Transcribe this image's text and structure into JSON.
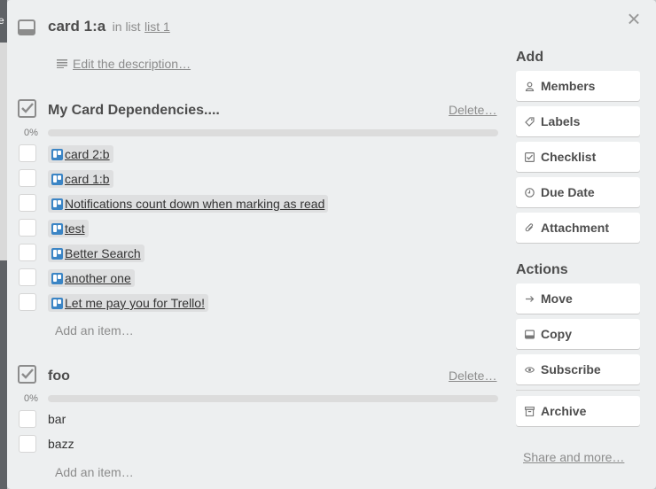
{
  "colors": {
    "modal_bg": "#edeff0",
    "trello_blue": "#3b85c5",
    "progress_track": "#dcdcdc",
    "muted": "#8c8c8c"
  },
  "card": {
    "title": "card 1:a",
    "in_list_prefix": "in list",
    "list_name": "list 1"
  },
  "description": {
    "link_label": "Edit the description…",
    "icon": "description-lines-icon"
  },
  "checklists": [
    {
      "title": "My Card Dependencies....",
      "delete_label": "Delete…",
      "progress_label": "0%",
      "progress": 0,
      "items": [
        {
          "text": "card 2:b",
          "card_link": true,
          "checked": false
        },
        {
          "text": "card 1:b",
          "card_link": true,
          "checked": false
        },
        {
          "text": "Notifications count down when marking as read",
          "card_link": true,
          "checked": false
        },
        {
          "text": "test",
          "card_link": true,
          "checked": false
        },
        {
          "text": "Better Search",
          "card_link": true,
          "checked": false
        },
        {
          "text": "another one",
          "card_link": true,
          "checked": false
        },
        {
          "text": "Let me pay you for Trello!",
          "card_link": true,
          "checked": false
        }
      ],
      "add_item_label": "Add an item…"
    },
    {
      "title": "foo",
      "delete_label": "Delete…",
      "progress_label": "0%",
      "progress": 0,
      "items": [
        {
          "text": "bar",
          "card_link": false,
          "checked": false
        },
        {
          "text": "bazz",
          "card_link": false,
          "checked": false
        }
      ],
      "add_item_label": "Add an item…"
    }
  ],
  "sidebar": {
    "add_heading": "Add",
    "add_buttons": [
      {
        "label": "Members",
        "icon": "person-icon"
      },
      {
        "label": "Labels",
        "icon": "tag-icon"
      },
      {
        "label": "Checklist",
        "icon": "checkbox-icon"
      },
      {
        "label": "Due Date",
        "icon": "clock-icon"
      },
      {
        "label": "Attachment",
        "icon": "paperclip-icon"
      }
    ],
    "actions_heading": "Actions",
    "action_buttons": [
      {
        "label": "Move",
        "icon": "arrow-right-icon"
      },
      {
        "label": "Copy",
        "icon": "copy-icon"
      },
      {
        "label": "Subscribe",
        "icon": "eye-icon"
      },
      {
        "label": "Archive",
        "icon": "archive-icon"
      }
    ],
    "share_label": "Share and more…"
  },
  "background": {
    "peek_letter": "e"
  }
}
